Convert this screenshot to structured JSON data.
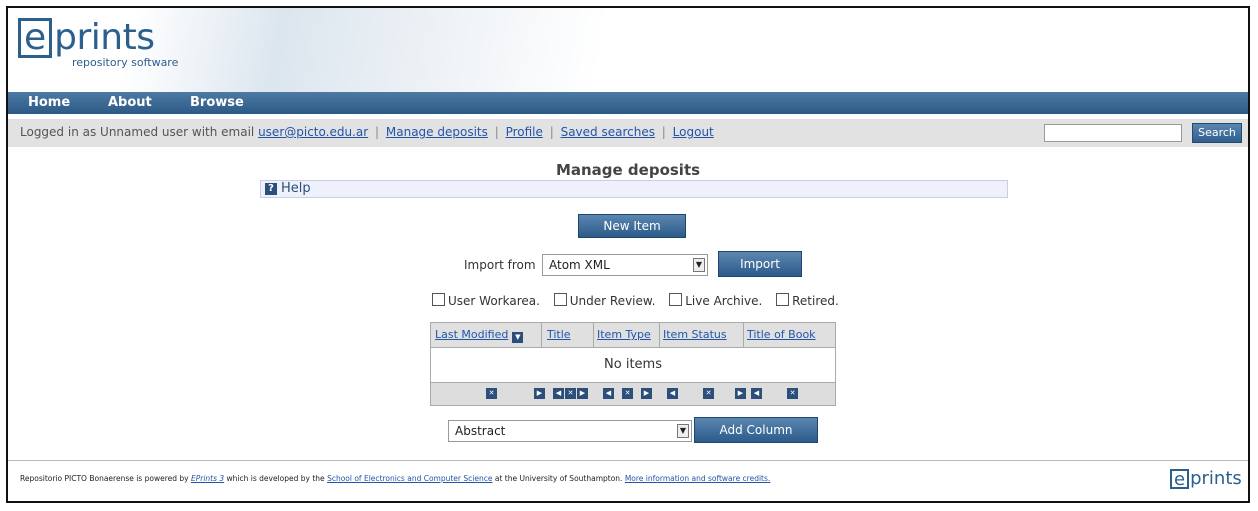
{
  "brand": {
    "logo_letter": "e",
    "logo_word": "prints",
    "tagline": "repository software"
  },
  "nav": {
    "items": [
      "Home",
      "About",
      "Browse"
    ]
  },
  "userbar": {
    "logged_in_prefix": "Logged in as Unnamed user with email",
    "email": "user@picto.edu.ar",
    "links": [
      "Manage deposits",
      "Profile",
      "Saved searches",
      "Logout"
    ],
    "search_button": "Search",
    "search_value": ""
  },
  "page": {
    "title": "Manage deposits",
    "help_label": "Help",
    "help_icon": "question-icon"
  },
  "actions": {
    "new_item": "New Item",
    "import_label": "Import from",
    "import_format": "Atom XML",
    "import_button": "Import",
    "column_select": "Abstract",
    "add_column_button": "Add Column"
  },
  "filters": [
    {
      "label": "User Workarea.",
      "checked": false
    },
    {
      "label": "Under Review.",
      "checked": false
    },
    {
      "label": "Live Archive.",
      "checked": false
    },
    {
      "label": "Retired.",
      "checked": false
    }
  ],
  "table": {
    "columns": [
      "Last Modified",
      "Title",
      "Item Type",
      "Item Status",
      "Title of Book"
    ],
    "empty_text": "No items"
  },
  "footer": {
    "text_1": "Repositorio PICTO Bonaerense is powered by",
    "link_eprints": "EPrints 3",
    "text_2": "which is developed by the",
    "link_school": "School of Electronics and Computer Science",
    "text_3": "at the University of Southampton.",
    "link_more": "More information and software credits."
  },
  "colors": {
    "brand_blue": "#2b5f8e",
    "nav_bg": "#2c5a86",
    "link": "#2255aa"
  }
}
